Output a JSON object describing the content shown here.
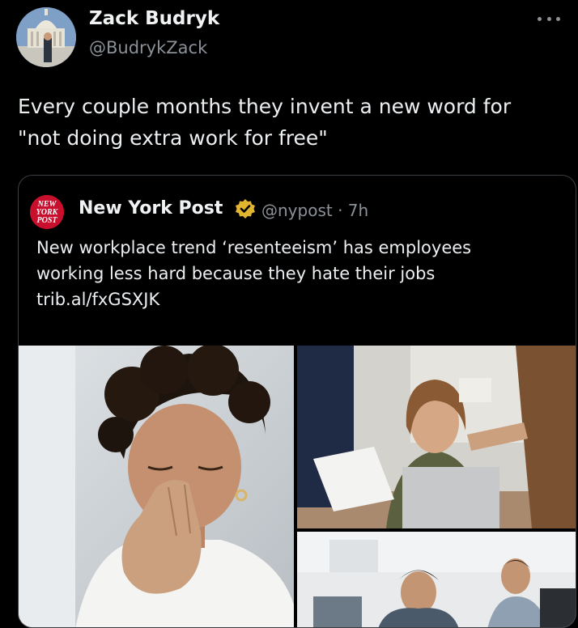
{
  "tweet": {
    "author_name": "Zack Budryk",
    "author_handle": "@BudrykZack",
    "text_lines": [
      "Every couple months they invent a new word for",
      "\"not doing extra work for free\""
    ]
  },
  "quoted_tweet": {
    "author_name": "New York Post",
    "logo_text": [
      "NEW",
      "YORK",
      "POST"
    ],
    "handle_time": "@nypost · 7h",
    "verified_badge_color": "#e2b531",
    "text_lines": [
      "New workplace trend ‘resenteeism’ has employees",
      "working less hard because they hate their jobs",
      "trib.al/fxGSXJK"
    ],
    "media": [
      {
        "icon": "woman-stressed-photo"
      },
      {
        "icon": "office-woman-with-papers-photo"
      },
      {
        "icon": "office-workers-photo"
      }
    ]
  },
  "colors": {
    "background": "#000000",
    "primary_text": "#e7e9ea",
    "secondary_text": "#8b9197",
    "card_border": "#3a3f44",
    "nypost_red": "#c8102e"
  }
}
